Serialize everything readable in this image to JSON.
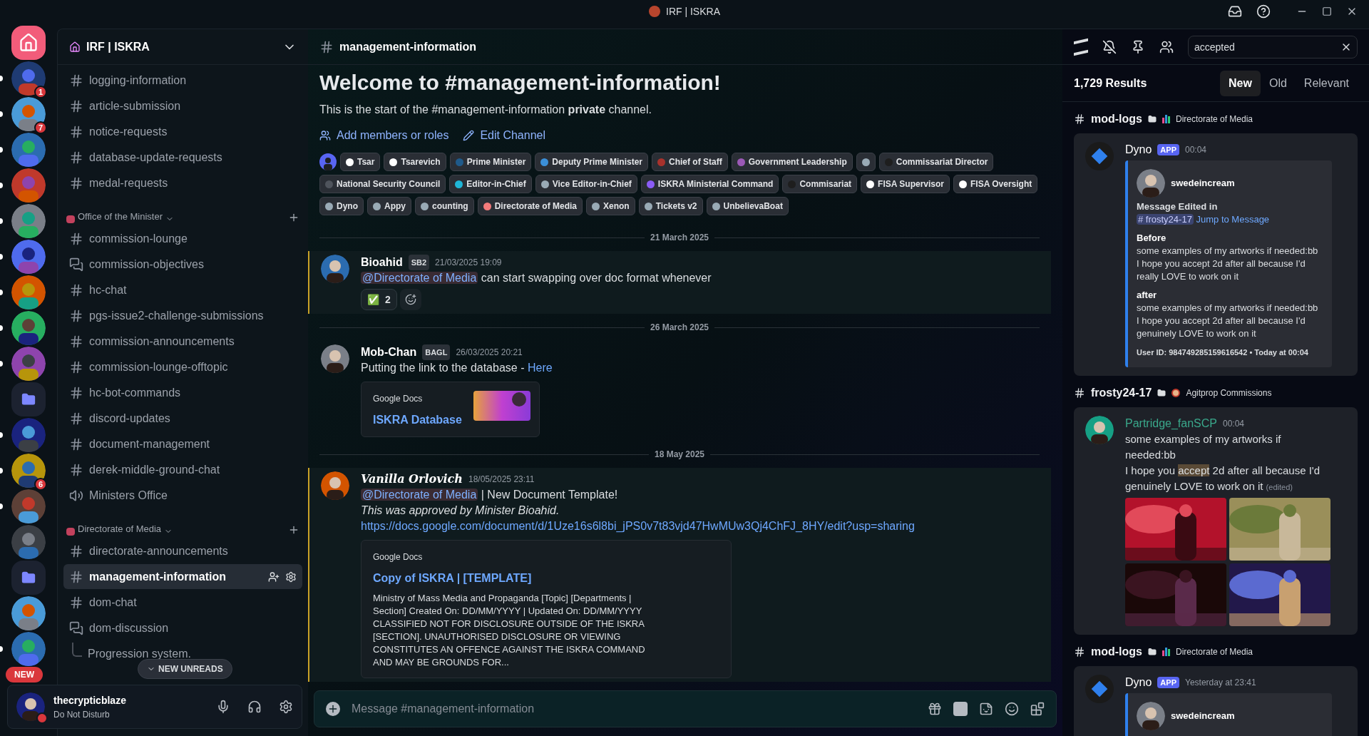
{
  "window": {
    "title": "IRF | ISKRA"
  },
  "servers": [
    {
      "kind": "home",
      "unread": false
    },
    {
      "kind": "server",
      "unread": true,
      "badge": "1"
    },
    {
      "kind": "server",
      "unread": true,
      "badge": "7"
    },
    {
      "kind": "server",
      "unread": true
    },
    {
      "kind": "server",
      "unread": true
    },
    {
      "kind": "server",
      "unread": true
    },
    {
      "kind": "server",
      "unread": true
    },
    {
      "kind": "server",
      "unread": true
    },
    {
      "kind": "server",
      "unread": true
    },
    {
      "kind": "server",
      "unread": true
    },
    {
      "kind": "folder",
      "unread": false
    },
    {
      "kind": "server",
      "unread": true
    },
    {
      "kind": "server",
      "unread": true,
      "badge": "6"
    },
    {
      "kind": "server",
      "unread": true
    },
    {
      "kind": "server",
      "unread": false
    },
    {
      "kind": "folder",
      "unread": false
    },
    {
      "kind": "server",
      "unread": false
    },
    {
      "kind": "server",
      "unread": true,
      "badge": "NEW"
    }
  ],
  "sidebar": {
    "server_name": "IRF | ISKRA",
    "sections": [
      {
        "channels": [
          {
            "kind": "text",
            "name": "logging-information",
            "selected": false
          },
          {
            "kind": "text",
            "name": "article-submission",
            "selected": false
          },
          {
            "kind": "text",
            "name": "notice-requests",
            "selected": false
          },
          {
            "kind": "text",
            "name": "database-update-requests",
            "selected": false
          },
          {
            "kind": "text",
            "name": "medal-requests",
            "selected": false
          }
        ]
      },
      {
        "category": "Office of the Minister",
        "channels": [
          {
            "kind": "text",
            "name": "commission-lounge",
            "selected": false
          },
          {
            "kind": "forum",
            "name": "commission-objectives",
            "selected": false
          },
          {
            "kind": "text",
            "name": "hc-chat",
            "selected": false
          },
          {
            "kind": "text",
            "name": "pgs-issue2-challenge-submissions",
            "selected": false
          },
          {
            "kind": "text",
            "name": "commission-announcements",
            "selected": false
          },
          {
            "kind": "text",
            "name": "commission-lounge-offtopic",
            "selected": false
          },
          {
            "kind": "text",
            "name": "hc-bot-commands",
            "selected": false
          },
          {
            "kind": "text",
            "name": "discord-updates",
            "selected": false
          },
          {
            "kind": "text",
            "name": "document-management",
            "selected": false
          },
          {
            "kind": "text",
            "name": "derek-middle-ground-chat",
            "selected": false
          },
          {
            "kind": "voice",
            "name": "Ministers Office",
            "selected": false
          }
        ]
      },
      {
        "category": "Directorate of Media",
        "channels": [
          {
            "kind": "text",
            "name": "directorate-announcements",
            "selected": false
          },
          {
            "kind": "text",
            "name": "management-information",
            "selected": true
          },
          {
            "kind": "text",
            "name": "dom-chat",
            "selected": false
          },
          {
            "kind": "forum",
            "name": "dom-discussion",
            "selected": false
          },
          {
            "kind": "thread",
            "name": "Progression system.",
            "selected": false
          }
        ]
      }
    ],
    "new_unreads": "NEW UNREADS"
  },
  "user": {
    "name": "thecrypticblaze",
    "status": "Do Not Disturb"
  },
  "channel": {
    "name": "management-information",
    "welcome_title": "Welcome to #management-information!",
    "welcome_text": "This is the start of the #management-information **private** channel.",
    "actions": [
      "Add members or roles",
      "Edit Channel"
    ],
    "roles": [
      {
        "name": "Tsar",
        "color": "#ffffff"
      },
      {
        "name": "Tsarevich",
        "color": "#ffffff"
      },
      {
        "name": "Prime Minister",
        "color": "#1f5a8a"
      },
      {
        "name": "Deputy Prime Minister",
        "color": "#3b8fd8"
      },
      {
        "name": "Chief of Staff",
        "color": "#a8322c"
      },
      {
        "name": "Government Leadership",
        "color": "#9b59b6"
      },
      {
        "color": "#99aab5"
      },
      {
        "name": "Commissariat Director",
        "color": "#1e1e1e"
      },
      {
        "name": "National Security Council",
        "color": "#4f545c"
      },
      {
        "name": "Editor-in-Chief",
        "color": "#1fb5d6"
      },
      {
        "name": "Vice Editor-in-Chief",
        "color": "#99aab5"
      },
      {
        "name": "ISKRA Ministerial Command",
        "color": "#8b5cf6"
      },
      {
        "name": "Commisariat",
        "color": "#1e1e1e"
      },
      {
        "name": "FISA Supervisor",
        "color": "#ffffff"
      },
      {
        "name": "FISA Oversight",
        "color": "#ffffff"
      },
      {
        "name": "Dyno",
        "color": "#99aab5"
      },
      {
        "name": "Appy",
        "color": "#99aab5"
      },
      {
        "name": "counting",
        "color": "#99aab5"
      },
      {
        "name": "Directorate of Media",
        "color": "#f47b7b"
      },
      {
        "name": "Xenon",
        "color": "#99aab5"
      },
      {
        "name": "Tickets v2",
        "color": "#99aab5"
      },
      {
        "name": "UnbelievaBoat",
        "color": "#99aab5"
      }
    ]
  },
  "messages": [
    {
      "kind": "divider",
      "text": "21 March 2025"
    },
    {
      "kind": "message",
      "author": {
        "kind": "plain",
        "name": "Bioahid"
      },
      "tag": "SB2",
      "time": "21/03/2025 19:09",
      "mentioned": true,
      "lines": [
        [
          {
            "kind": "mention",
            "text": "@Directorate of Media"
          },
          {
            "kind": "text",
            "text": " can start swapping over doc format whenever"
          }
        ]
      ],
      "reactions": [
        {
          "emoji": "✅",
          "count": "2"
        }
      ]
    },
    {
      "kind": "divider",
      "text": "26 March 2025"
    },
    {
      "kind": "message",
      "author": {
        "kind": "plain",
        "name": "Mob-Chan"
      },
      "tag": "BAGL",
      "time": "26/03/2025 20:21",
      "mentioned": false,
      "lines": [
        [
          {
            "kind": "text",
            "text": "Putting the link to the database - "
          },
          {
            "kind": "link",
            "text": "Here"
          }
        ]
      ],
      "embed": {
        "kind": "thumbnail",
        "provider": "Google Docs",
        "title": "ISKRA Database"
      }
    },
    {
      "kind": "divider",
      "text": "18 May 2025"
    },
    {
      "kind": "message",
      "author": {
        "kind": "fancy",
        "name": "Vanilla Orlovich"
      },
      "time": "18/05/2025 23:11",
      "mentioned": true,
      "lines": [
        [
          {
            "kind": "mention",
            "text": "@Directorate of Media"
          },
          {
            "kind": "text",
            "text": " | New Document Template!"
          }
        ],
        [
          {
            "kind": "italic",
            "text": "This was approved by Minister Bioahid."
          }
        ],
        [
          {
            "kind": "link",
            "text": "https://docs.google.com/document/d/1Uze16s6l8bi_jPS0v7t83vjd47HwMUw3Qj4ChFJ_8HY/edit?usp=sharing"
          }
        ]
      ],
      "embed": {
        "kind": "loading",
        "provider": "Google Docs",
        "title": "Copy of ISKRA | [TEMPLATE]",
        "description": "Ministry of Mass Media and Propaganda [Topic] [Departments | Section] Created On: DD/MM/YYYY | Updated On: DD/MM/YYYY CLASSIFIED NOT FOR DISCLOSURE OUTSIDE OF THE ISKRA [SECTION]. UNAUTHORISED DISCLOSURE OR VIEWING CONSTITUTES AN OFFENCE AGAINST THE ISKRA COMMAND AND MAY BE GROUNDS FOR..."
      }
    }
  ],
  "composer": {
    "placeholder": "Message #management-information"
  },
  "search": {
    "query": "accepted",
    "count": "1,729 Results",
    "sort_tabs": [
      {
        "label": "New",
        "selected": true
      },
      {
        "label": "Old",
        "selected": false
      },
      {
        "label": "Relevant",
        "selected": false
      }
    ],
    "results": [
      {
        "channel": "mod-logs",
        "category": {
          "kind": "chart",
          "name": "Directorate of Media"
        },
        "author": {
          "kind": "bot",
          "name": "Dyno"
        },
        "app_tag": "APP",
        "time": "00:04",
        "embed": {
          "author": "swedeincream",
          "lines": [
            [
              {
                "kind": "bold",
                "text": "Message Edited in "
              },
              {
                "kind": "channel",
                "text": "# frosty24-17"
              },
              {
                "kind": "link",
                "text": " Jump to Message"
              }
            ]
          ],
          "fields": [
            {
              "name": "Before",
              "lines": [
                "some examples of my artworks if needed:bb",
                "I hope you accept 2d after all because I'd really LOVE to work on it"
              ]
            },
            {
              "name": "after",
              "lines": [
                "some examples of my artworks if needed:bb",
                "I hope you accept 2d after all because I'd genuinely LOVE to work on it"
              ]
            }
          ],
          "footer": "User ID: 984749285159616542 • Today at 00:04"
        }
      },
      {
        "channel": "frosty24-17",
        "category": {
          "kind": "palette",
          "name": "Agitprop Commissions"
        },
        "author": {
          "kind": "user",
          "name": "Partridge_fanSCP"
        },
        "time": "00:04",
        "lines": [
          [
            {
              "kind": "text",
              "text": "some examples of my artworks if needed:bb"
            }
          ],
          [
            {
              "kind": "text",
              "text": "I hope you "
            },
            {
              "kind": "highlight",
              "text": "accept"
            },
            {
              "kind": "text",
              "text": " 2d after all because I'd genuinely LOVE to work on it "
            },
            {
              "kind": "small",
              "text": "(edited)"
            }
          ]
        ],
        "images": [
          {
            "kind": "picture"
          },
          {
            "kind": "picture"
          },
          {
            "kind": "picture"
          },
          {
            "kind": "picture"
          }
        ]
      },
      {
        "channel": "mod-logs",
        "category": {
          "kind": "chart",
          "name": "Directorate of Media"
        },
        "author": {
          "kind": "bot",
          "name": "Dyno"
        },
        "app_tag": "APP",
        "time": "Yesterday at 23:41",
        "embed": {
          "author": "swedeincream"
        }
      }
    ]
  }
}
